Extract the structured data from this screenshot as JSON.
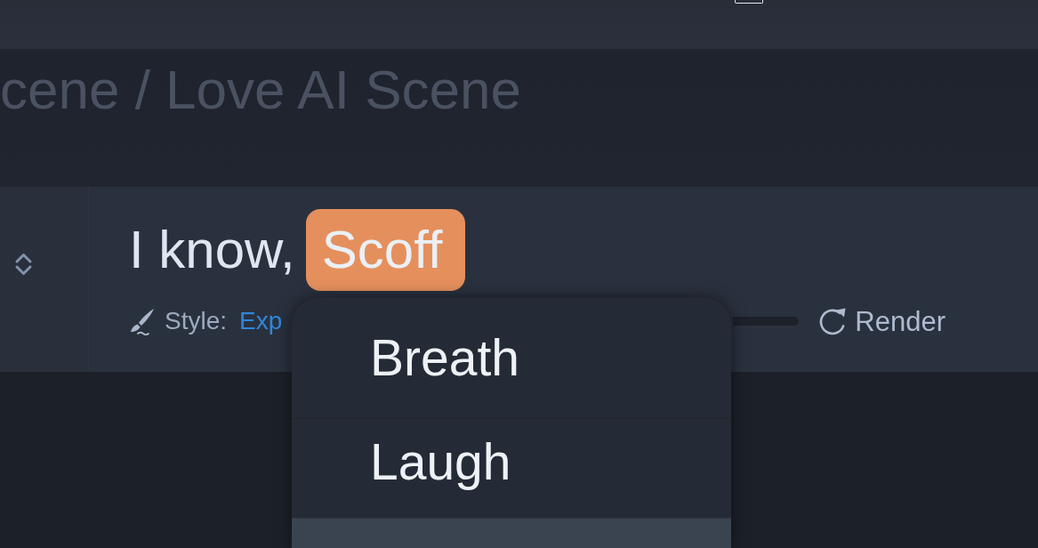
{
  "page_title": "cene / Love AI Scene",
  "line": {
    "text": "I know,",
    "tag": "Scoff",
    "style_label": "Style:",
    "style_value": "Exp",
    "render_button": "Render"
  },
  "dropdown": {
    "items": [
      {
        "label": "Breath",
        "selected": false
      },
      {
        "label": "Laugh",
        "selected": false
      },
      {
        "selected": true
      }
    ]
  }
}
